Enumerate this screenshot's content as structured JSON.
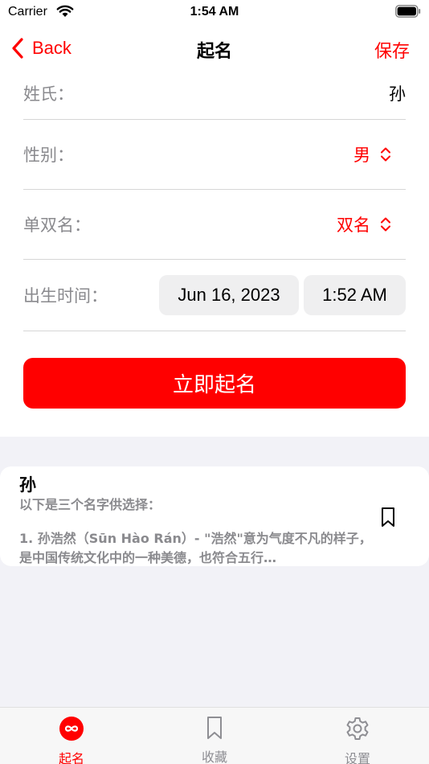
{
  "status_bar": {
    "carrier": "Carrier",
    "time": "1:54 AM"
  },
  "nav": {
    "back_label": "Back",
    "title": "起名",
    "save_label": "保存"
  },
  "form": {
    "surname": {
      "label": "姓氏：",
      "value": "孙"
    },
    "gender": {
      "label": "性别：",
      "value": "男"
    },
    "name_length": {
      "label": "单双名：",
      "value": "双名"
    },
    "birth": {
      "label": "出生时间：",
      "date": "Jun 16, 2023",
      "time": "1:52 AM"
    }
  },
  "generate_button": "立即起名",
  "result": {
    "title": "孙",
    "subtitle": "以下是三个名字供选择：",
    "body": "1. 孙浩然（Sūn Hào Rán）- \"浩然\"意为气度不凡的样子，是中国传统文化中的一种美德，也符合五行…"
  },
  "tabs": [
    {
      "label": "起名",
      "icon": "infinity-icon",
      "active": true
    },
    {
      "label": "收藏",
      "icon": "bookmark-icon",
      "active": false
    },
    {
      "label": "设置",
      "icon": "gear-icon",
      "active": false
    }
  ],
  "colors": {
    "accent": "#ff0000",
    "secondary_text": "#8a8a8e",
    "inactive_tab": "#8e8e93",
    "background": "#f2f2f7"
  }
}
